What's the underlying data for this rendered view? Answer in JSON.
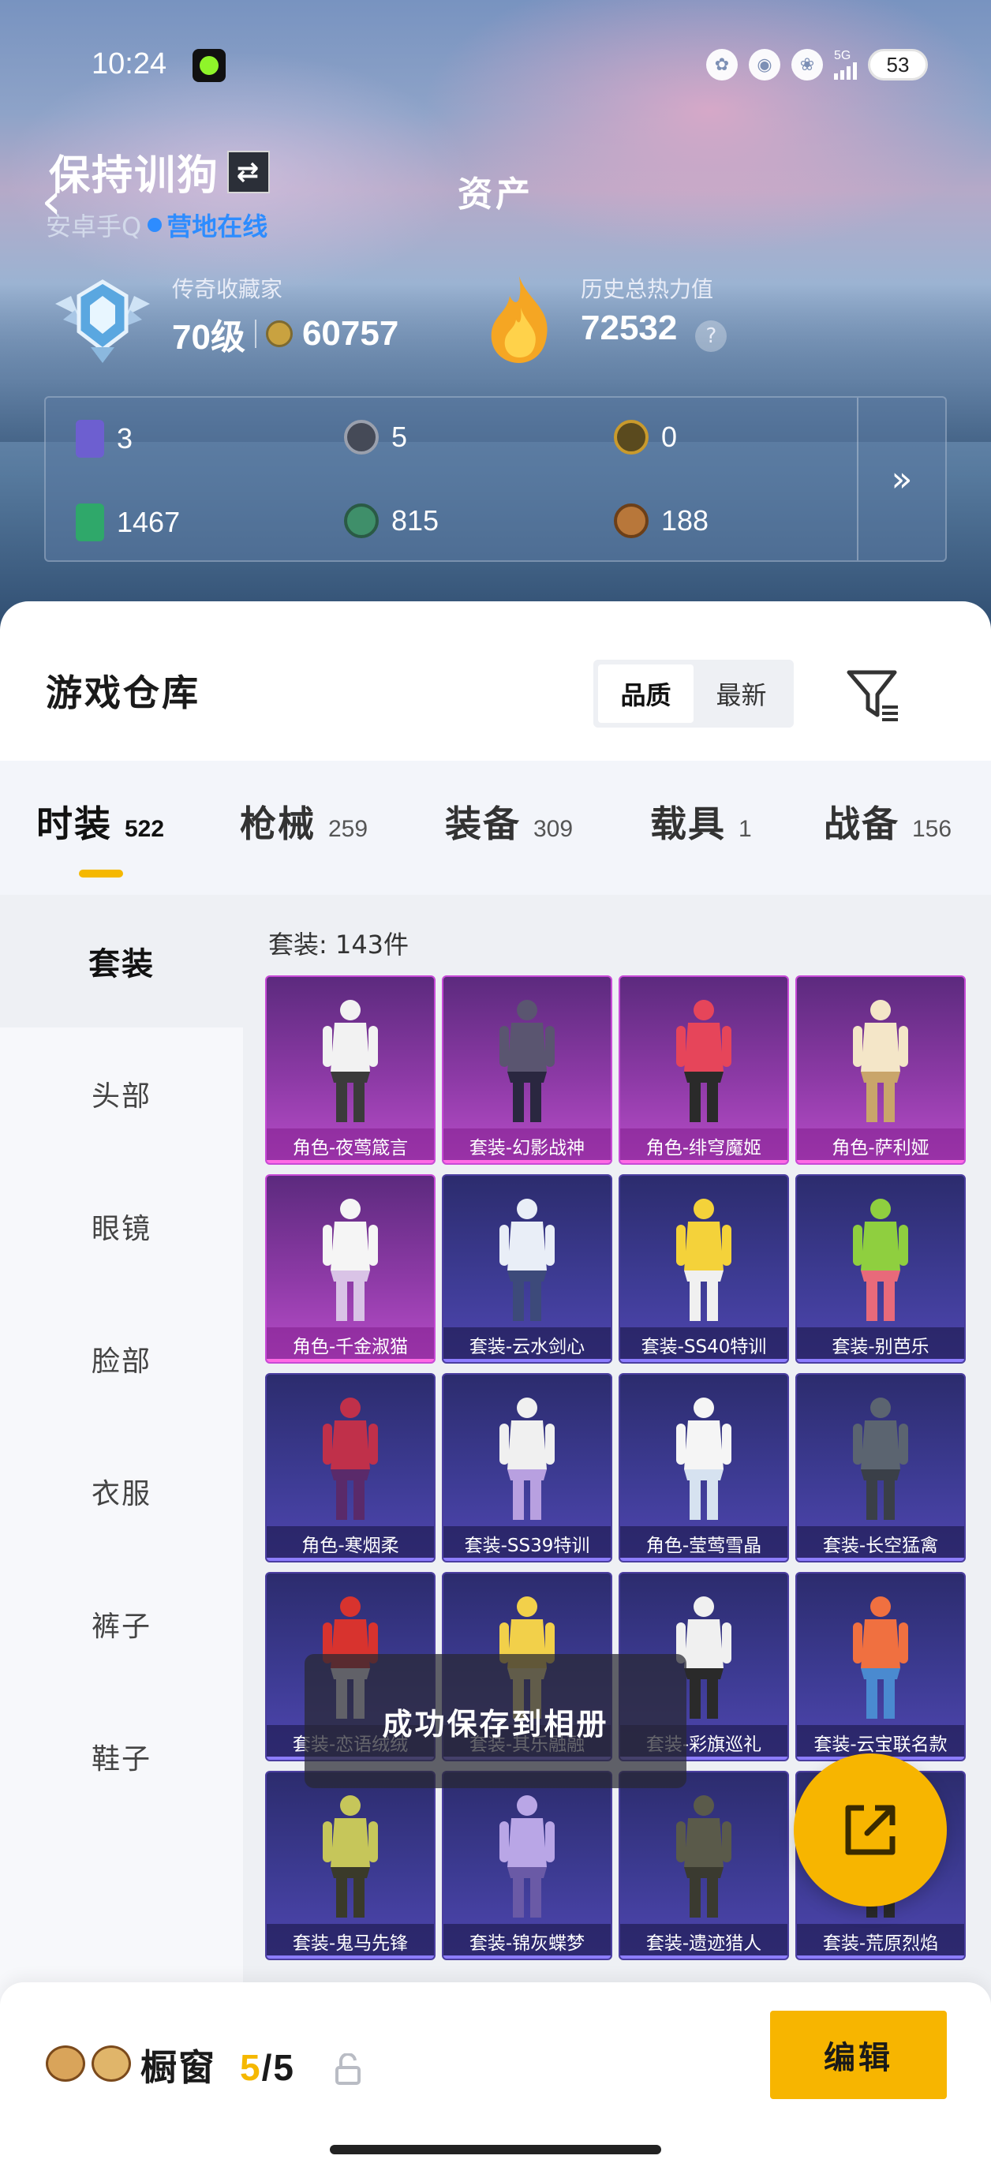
{
  "status": {
    "time": "10:24",
    "network": "5G",
    "battery": "53"
  },
  "header": {
    "username": "保持训狗",
    "title": "资产",
    "account_type": "安卓手Q",
    "online_status": "营地在线",
    "collector_label": "传奇收藏家",
    "level": "70级",
    "points": "60757",
    "heat_label": "历史总热力值",
    "heat_value": "72532",
    "help": "?"
  },
  "resources": [
    {
      "value": "3",
      "color": "#6d5fd0"
    },
    {
      "value": "5",
      "color": "#6a6f7c"
    },
    {
      "value": "0",
      "color": "#c99a2c"
    },
    {
      "value": "1467",
      "color": "#2fa86a"
    },
    {
      "value": "815",
      "color": "#3f8f6a"
    },
    {
      "value": "188",
      "color": "#b8773a"
    }
  ],
  "more_label": "»",
  "warehouse": {
    "title": "游戏仓库",
    "sort_quality": "品质",
    "sort_latest": "最新"
  },
  "tabs": [
    {
      "label": "时装",
      "count": "522"
    },
    {
      "label": "枪械",
      "count": "259"
    },
    {
      "label": "装备",
      "count": "309"
    },
    {
      "label": "载具",
      "count": "1"
    },
    {
      "label": "战备",
      "count": "156"
    }
  ],
  "sidebar": [
    "套装",
    "头部",
    "眼镜",
    "脸部",
    "衣服",
    "裤子",
    "鞋子"
  ],
  "grid_count": "套装: 143件",
  "items": [
    {
      "name": "角色-夜莺箴言",
      "type": "role"
    },
    {
      "name": "套装-幻影战神",
      "type": "role"
    },
    {
      "name": "角色-绯穹魔姬",
      "type": "role"
    },
    {
      "name": "角色-萨利娅",
      "type": "role"
    },
    {
      "name": "角色-千金淑猫",
      "type": "role"
    },
    {
      "name": "套装-云水剑心",
      "type": "set"
    },
    {
      "name": "套装-SS40特训",
      "type": "set"
    },
    {
      "name": "套装-别芭乐",
      "type": "set"
    },
    {
      "name": "角色-寒烟柔",
      "type": "set"
    },
    {
      "name": "套装-SS39特训",
      "type": "set"
    },
    {
      "name": "角色-莹莺雪晶",
      "type": "set"
    },
    {
      "name": "套装-长空猛禽",
      "type": "set"
    },
    {
      "name": "套装-恋语绒绒",
      "type": "set"
    },
    {
      "name": "套装-其乐融融",
      "type": "set"
    },
    {
      "name": "套装-彩旗巡礼",
      "type": "set"
    },
    {
      "name": "套装-云宝联名款",
      "type": "set"
    },
    {
      "name": "套装-鬼马先锋",
      "type": "set"
    },
    {
      "name": "套装-锦灰蝶梦",
      "type": "set"
    },
    {
      "name": "套装-遗迹猎人",
      "type": "set"
    },
    {
      "name": "套装-荒原烈焰",
      "type": "set"
    }
  ],
  "toast": "成功保存到相册",
  "showcase": {
    "label": "橱窗",
    "current": "5",
    "total": "/5",
    "edit": "编辑"
  },
  "colors": {
    "accent": "#f7b500",
    "online": "#2d8cff"
  }
}
